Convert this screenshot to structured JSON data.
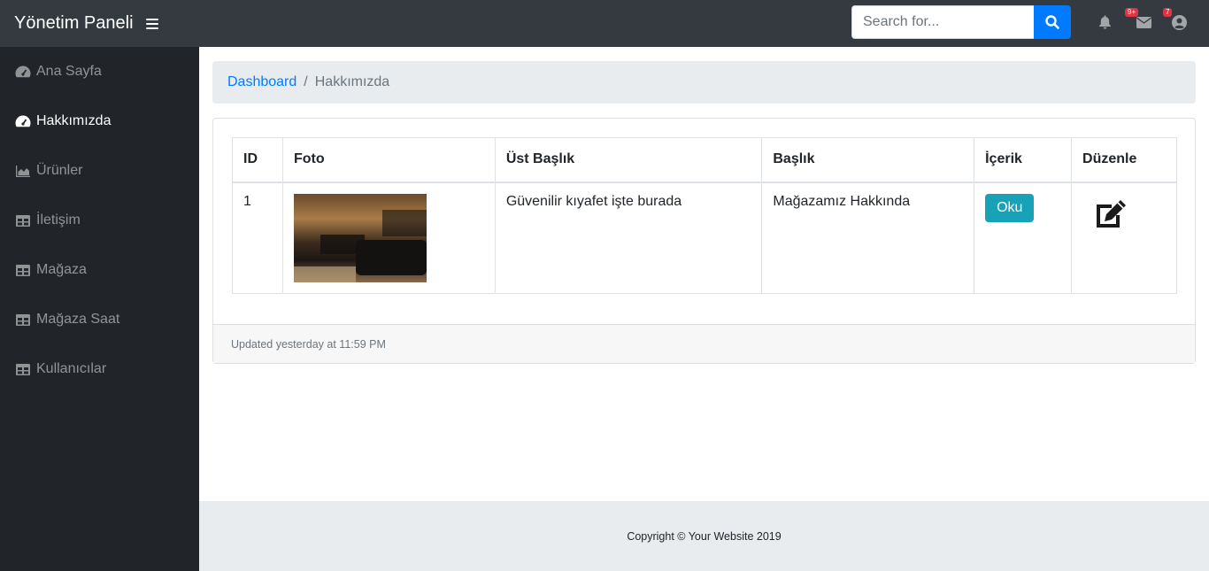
{
  "topbar": {
    "brand": "Yönetim Paneli",
    "search_placeholder": "Search for...",
    "alerts_badge": "9+",
    "messages_badge": "7"
  },
  "sidebar": {
    "items": [
      {
        "label": "Ana Sayfa",
        "icon": "tachometer-icon"
      },
      {
        "label": "Hakkımızda",
        "icon": "tachometer-icon"
      },
      {
        "label": "Ürünler",
        "icon": "chart-area-icon"
      },
      {
        "label": "İletişim",
        "icon": "table-icon"
      },
      {
        "label": "Mağaza",
        "icon": "table-icon"
      },
      {
        "label": "Mağaza Saat",
        "icon": "table-icon"
      },
      {
        "label": "Kullanıcılar",
        "icon": "table-icon"
      }
    ],
    "active_index": 1
  },
  "breadcrumb": {
    "root": "Dashboard",
    "separator": "/",
    "current": "Hakkımızda"
  },
  "table": {
    "headers": [
      "ID",
      "Foto",
      "Üst Başlık",
      "Başlık",
      "İçerik",
      "Düzenle"
    ],
    "rows": [
      {
        "id": "1",
        "ust_baslik": "Güvenilir kıyafet işte burada",
        "baslik": "Mağazamız Hakkında",
        "read_label": "Oku"
      }
    ]
  },
  "card_footer": "Updated yesterday at 11:59 PM",
  "footer": "Copyright © Your Website 2019",
  "colors": {
    "topbar": "#343a40",
    "sidebar": "#212529",
    "primary": "#007bff",
    "info": "#17a2b8",
    "danger": "#dc3545"
  }
}
